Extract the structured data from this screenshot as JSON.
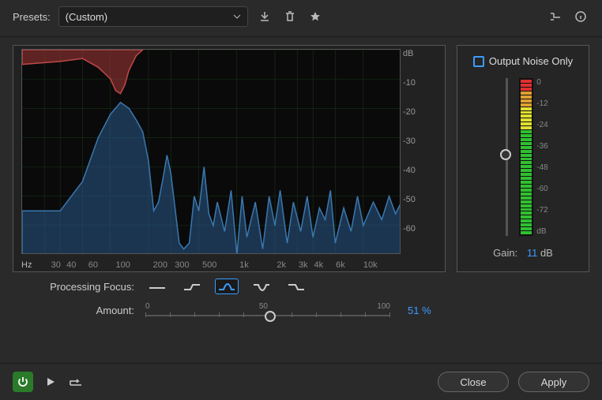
{
  "toolbar": {
    "presets_label": "Presets:",
    "preset_value": "(Custom)"
  },
  "chart_data": {
    "type": "area",
    "xlabel": "Hz",
    "ylabel": "dB",
    "x_ticks": [
      "30",
      "40",
      "60",
      "",
      "100",
      "",
      "200",
      "300",
      "",
      "500",
      "",
      "",
      "",
      "1k",
      "",
      "2k",
      "",
      "3k",
      "4k",
      "",
      "6k",
      "",
      "",
      "10k"
    ],
    "y_ticks": [
      "dB",
      "-10",
      "-20",
      "-30",
      "-40",
      "-50",
      "-60"
    ],
    "ylim": [
      -70,
      0
    ],
    "xlim_hz": [
      20,
      20000
    ],
    "series": [
      {
        "name": "noise-profile",
        "color": "#a83838",
        "points_hz_db": [
          [
            20,
            -5
          ],
          [
            40,
            -4
          ],
          [
            60,
            -3
          ],
          [
            80,
            -6
          ],
          [
            100,
            -10
          ],
          [
            110,
            -14
          ],
          [
            120,
            -15
          ],
          [
            130,
            -12
          ],
          [
            140,
            -7
          ],
          [
            160,
            -2
          ],
          [
            180,
            0
          ]
        ]
      },
      {
        "name": "signal-spectrum",
        "color": "#2a5a8a",
        "points_hz_db": [
          [
            20,
            -55
          ],
          [
            40,
            -55
          ],
          [
            60,
            -45
          ],
          [
            80,
            -30
          ],
          [
            100,
            -22
          ],
          [
            120,
            -18
          ],
          [
            140,
            -20
          ],
          [
            160,
            -24
          ],
          [
            180,
            -28
          ],
          [
            200,
            -38
          ],
          [
            220,
            -55
          ],
          [
            240,
            -52
          ],
          [
            260,
            -44
          ],
          [
            280,
            -36
          ],
          [
            300,
            -42
          ],
          [
            350,
            -66
          ],
          [
            380,
            -68
          ],
          [
            420,
            -66
          ],
          [
            460,
            -50
          ],
          [
            500,
            -55
          ],
          [
            550,
            -40
          ],
          [
            600,
            -56
          ],
          [
            650,
            -60
          ],
          [
            700,
            -52
          ],
          [
            800,
            -62
          ],
          [
            900,
            -48
          ],
          [
            1000,
            -70
          ],
          [
            1100,
            -50
          ],
          [
            1200,
            -64
          ],
          [
            1400,
            -52
          ],
          [
            1600,
            -68
          ],
          [
            1800,
            -50
          ],
          [
            2000,
            -60
          ],
          [
            2200,
            -48
          ],
          [
            2500,
            -66
          ],
          [
            2800,
            -52
          ],
          [
            3200,
            -62
          ],
          [
            3600,
            -50
          ],
          [
            4000,
            -64
          ],
          [
            4500,
            -54
          ],
          [
            5000,
            -58
          ],
          [
            5500,
            -48
          ],
          [
            6000,
            -66
          ],
          [
            7000,
            -54
          ],
          [
            8000,
            -62
          ],
          [
            9000,
            -50
          ],
          [
            10000,
            -60
          ],
          [
            12000,
            -52
          ],
          [
            14000,
            -58
          ],
          [
            16000,
            -50
          ],
          [
            18000,
            -56
          ],
          [
            20000,
            -52
          ]
        ]
      }
    ]
  },
  "side": {
    "output_noise_label": "Output Noise Only",
    "output_noise_checked": false,
    "meter_ticks": [
      "0",
      "-12",
      "-24",
      "-36",
      "-48",
      "-60",
      "-72",
      "dB"
    ],
    "gain_label": "Gain:",
    "gain_value": "11",
    "gain_unit": "dB"
  },
  "controls": {
    "focus_label": "Processing Focus:",
    "focus_options": [
      "flat",
      "lowshelf",
      "peak",
      "notch",
      "highshelf"
    ],
    "focus_selected": 2,
    "amount_label": "Amount:",
    "amount_min": "0",
    "amount_mid": "50",
    "amount_max": "100",
    "amount_value": "51",
    "amount_unit": "%"
  },
  "buttons": {
    "close": "Close",
    "apply": "Apply"
  }
}
